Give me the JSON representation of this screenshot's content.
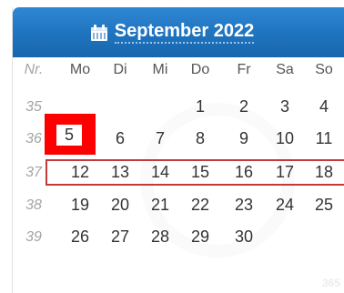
{
  "header": {
    "title": "September 2022",
    "icon": "calendar-icon"
  },
  "weekday_header": [
    "Nr.",
    "Mo",
    "Di",
    "Mi",
    "Do",
    "Fr",
    "Sa",
    "So"
  ],
  "weeks": [
    {
      "nr": "35",
      "days": [
        "",
        "",
        "",
        "1",
        "2",
        "3",
        "4"
      ]
    },
    {
      "nr": "36",
      "days": [
        "5",
        "6",
        "7",
        "8",
        "9",
        "10",
        "11"
      ]
    },
    {
      "nr": "37",
      "days": [
        "12",
        "13",
        "14",
        "15",
        "16",
        "17",
        "18"
      ]
    },
    {
      "nr": "38",
      "days": [
        "19",
        "20",
        "21",
        "22",
        "23",
        "24",
        "25"
      ]
    },
    {
      "nr": "39",
      "days": [
        "26",
        "27",
        "28",
        "29",
        "30",
        "",
        ""
      ]
    }
  ],
  "highlight": {
    "today": "5",
    "today_color": "#ff0000",
    "outlined_week": "37",
    "outline_color": "#c23a3a"
  },
  "accent_color": "#1f73be"
}
